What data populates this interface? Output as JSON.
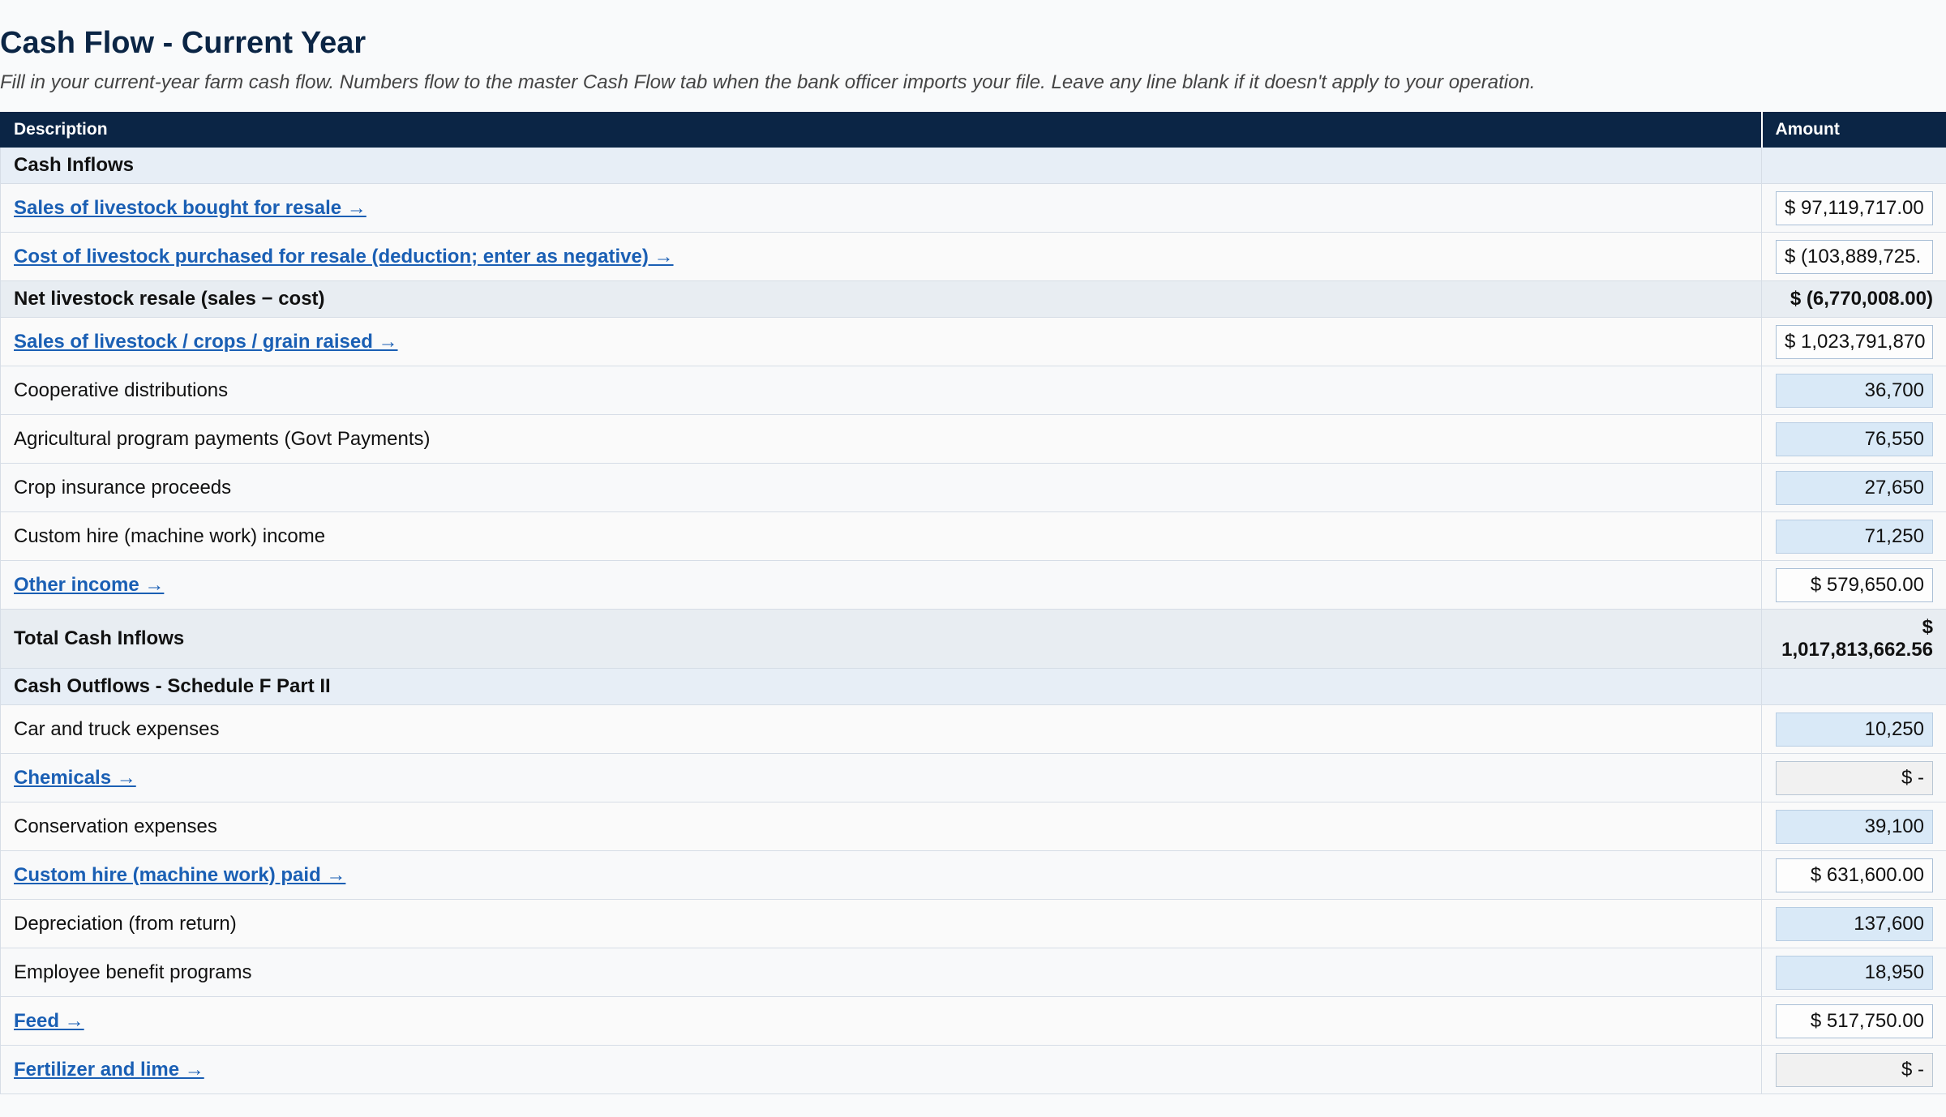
{
  "page": {
    "title": "Cash Flow - Current Year",
    "subtitle": "Fill in your current-year farm cash flow. Numbers flow to the master Cash Flow tab when the bank officer imports your file. Leave any line blank if it doesn't apply to your operation."
  },
  "table": {
    "headers": {
      "description": "Description",
      "amount": "Amount"
    },
    "rows": [
      {
        "kind": "section",
        "label": "Cash Inflows"
      },
      {
        "kind": "link",
        "label": "Sales of livestock bought for resale →",
        "value": "$ 97,119,717.00",
        "box": "link"
      },
      {
        "kind": "link",
        "label": "Cost of livestock purchased for resale (deduction; enter as negative) →",
        "value": "$ (103,889,725.",
        "box": "link"
      },
      {
        "kind": "subtotal",
        "label": "Net livestock resale (sales − cost)",
        "value": "$ (6,770,008.00)"
      },
      {
        "kind": "link",
        "label": "Sales of livestock / crops / grain raised →",
        "value": "$ 1,023,791,870",
        "box": "link"
      },
      {
        "kind": "input",
        "label": "Cooperative distributions",
        "value": "36,700"
      },
      {
        "kind": "input",
        "label": "Agricultural program payments (Govt Payments)",
        "value": "76,550"
      },
      {
        "kind": "input",
        "label": "Crop insurance proceeds",
        "value": "27,650"
      },
      {
        "kind": "input",
        "label": "Custom hire (machine work) income",
        "value": "71,250"
      },
      {
        "kind": "link",
        "label": "Other income →",
        "value": "$ 579,650.00",
        "box": "link-right"
      },
      {
        "kind": "total",
        "label": "Total Cash Inflows",
        "value_line1": "$",
        "value_line2": "1,017,813,662.56"
      },
      {
        "kind": "section",
        "label": "Cash Outflows - Schedule F Part II"
      },
      {
        "kind": "input",
        "label": "Car and truck expenses",
        "value": "10,250"
      },
      {
        "kind": "link",
        "label": "Chemicals →",
        "value": "$ -",
        "box": "empty"
      },
      {
        "kind": "input",
        "label": "Conservation expenses",
        "value": "39,100"
      },
      {
        "kind": "link",
        "label": "Custom hire (machine work) paid →",
        "value": "$ 631,600.00",
        "box": "link-right"
      },
      {
        "kind": "input",
        "label": "Depreciation (from return)",
        "value": "137,600"
      },
      {
        "kind": "input",
        "label": "Employee benefit programs",
        "value": "18,950"
      },
      {
        "kind": "link",
        "label": "Feed →",
        "value": "$ 517,750.00",
        "box": "link-right"
      },
      {
        "kind": "link",
        "label": "Fertilizer and lime →",
        "value": "$ -",
        "box": "empty"
      }
    ]
  },
  "colors": {
    "header_bg": "#0b2545",
    "link": "#1a5fb4",
    "input_fill": "#d9e9f7",
    "section_bg": "#e7eef6"
  }
}
